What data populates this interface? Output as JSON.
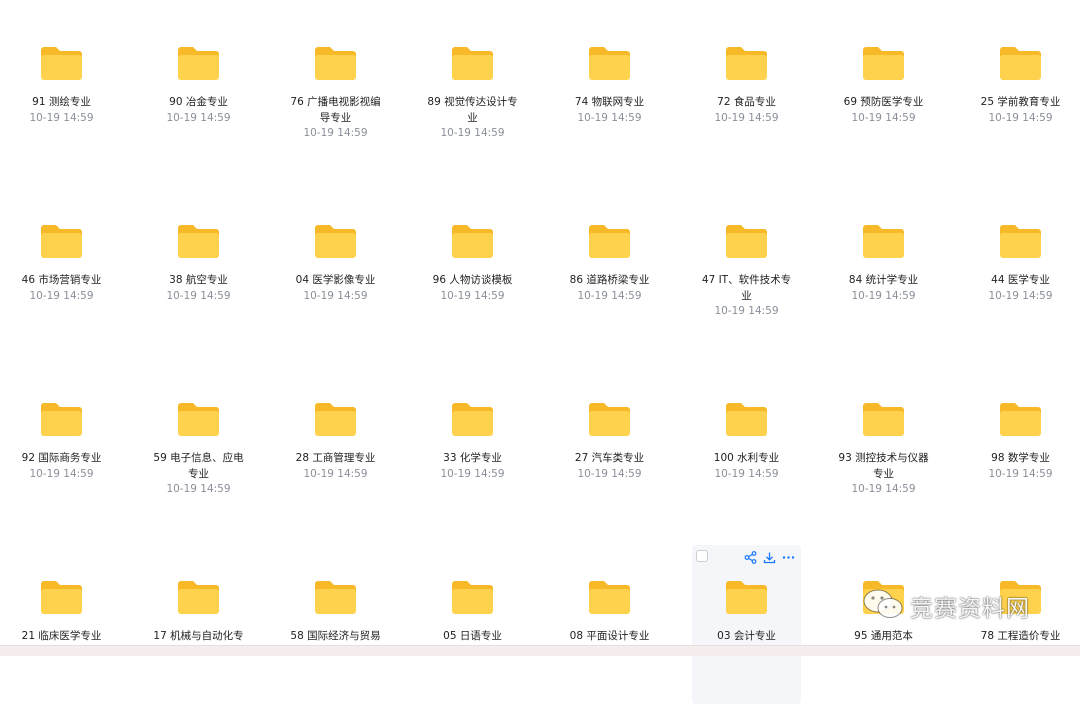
{
  "folders": [
    {
      "name": "91 测绘专业",
      "date": "10-19 14:59"
    },
    {
      "name": "90 冶金专业",
      "date": "10-19 14:59"
    },
    {
      "name": "76 广播电视影视编导专业",
      "date": "10-19 14:59"
    },
    {
      "name": "89 视觉传达设计专业",
      "date": "10-19 14:59"
    },
    {
      "name": "74 物联网专业",
      "date": "10-19 14:59"
    },
    {
      "name": "72 食品专业",
      "date": "10-19 14:59"
    },
    {
      "name": "69 预防医学专业",
      "date": "10-19 14:59"
    },
    {
      "name": "25 学前教育专业",
      "date": "10-19 14:59"
    },
    {
      "name": "46 市场营销专业",
      "date": "10-19 14:59"
    },
    {
      "name": "38 航空专业",
      "date": "10-19 14:59"
    },
    {
      "name": "04 医学影像专业",
      "date": "10-19 14:59"
    },
    {
      "name": "96 人物访谈模板",
      "date": "10-19 14:59"
    },
    {
      "name": "86 道路桥梁专业",
      "date": "10-19 14:59"
    },
    {
      "name": "47 IT、软件技术专业",
      "date": "10-19 14:59"
    },
    {
      "name": "84 统计学专业",
      "date": "10-19 14:59"
    },
    {
      "name": "44 医学专业",
      "date": "10-19 14:59"
    },
    {
      "name": "92 国际商务专业",
      "date": "10-19 14:59"
    },
    {
      "name": "59 电子信息、应电专业",
      "date": "10-19 14:59"
    },
    {
      "name": "28 工商管理专业",
      "date": "10-19 14:59"
    },
    {
      "name": "33 化学专业",
      "date": "10-19 14:59"
    },
    {
      "name": "27 汽车类专业",
      "date": "10-19 14:59"
    },
    {
      "name": "100 水利专业",
      "date": "10-19 14:59"
    },
    {
      "name": "93 测控技术与仪器专业",
      "date": "10-19 14:59"
    },
    {
      "name": "98 数学专业",
      "date": "10-19 14:59"
    },
    {
      "name": "21 临床医学专业",
      "date": ""
    },
    {
      "name": "17 机械与自动化专",
      "date": ""
    },
    {
      "name": "58 国际经济与贸易",
      "date": ""
    },
    {
      "name": "05 日语专业",
      "date": ""
    },
    {
      "name": "08 平面设计专业",
      "date": ""
    },
    {
      "name": "03 会计专业",
      "date": "",
      "hovered": true
    },
    {
      "name": "95 通用范本",
      "date": ""
    },
    {
      "name": "78 工程造价专业",
      "date": ""
    }
  ],
  "hover_actions": [
    "share-icon",
    "download-icon",
    "more-icon"
  ],
  "watermark": {
    "text": "竞赛资料网",
    "icon": "wechat-icon"
  },
  "colors": {
    "folder_back": "#f7b928",
    "folder_front": "#ffd24d",
    "action_blue": "#1677ff",
    "date_gray": "#8a8f99"
  }
}
